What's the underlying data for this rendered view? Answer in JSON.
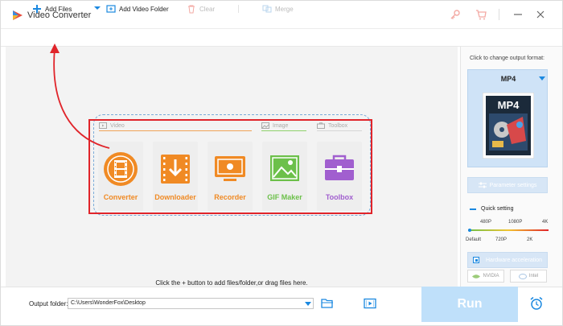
{
  "app": {
    "title": "Video Converter"
  },
  "toolbar": {
    "add_files": "Add Files",
    "add_video_folder": "Add Video Folder",
    "clear": "Clear",
    "merge": "Merge"
  },
  "main": {
    "groups": {
      "video": "Video",
      "image": "Image",
      "toolbox": "Toolbox"
    },
    "tools": [
      {
        "label": "Converter",
        "color": "#f08a24",
        "icon": "film-icon"
      },
      {
        "label": "Downloader",
        "color": "#f08a24",
        "icon": "download-icon"
      },
      {
        "label": "Recorder",
        "color": "#f08a24",
        "icon": "screen-record-icon"
      },
      {
        "label": "GIF Maker",
        "color": "#6cc04a",
        "icon": "image-icon"
      },
      {
        "label": "Toolbox",
        "color": "#a15fcf",
        "icon": "toolbox-icon"
      }
    ],
    "hint": "Click the + button to add files/folder,or drag files here."
  },
  "right_panel": {
    "title": "Click to change output format:",
    "format": "MP4",
    "format_thumb_text": "MP4",
    "parameter_settings": "Parameter settings",
    "quick_setting": "Quick setting",
    "quality_top": [
      "480P",
      "1080P",
      "4K"
    ],
    "quality_bottom": [
      "Default",
      "720P",
      "2K"
    ],
    "hardware_acceleration": "Hardware acceleration",
    "nvidia": "NVIDIA",
    "intel": "Intel"
  },
  "bottom": {
    "output_folder_label": "Output folder:",
    "output_folder_value": "C:\\Users\\WonderFox\\Desktop",
    "run": "Run"
  },
  "colors": {
    "accent": "#1a88e0",
    "highlight": "#e0242a",
    "orange": "#f08a24",
    "green": "#6cc04a",
    "purple": "#a15fcf"
  }
}
